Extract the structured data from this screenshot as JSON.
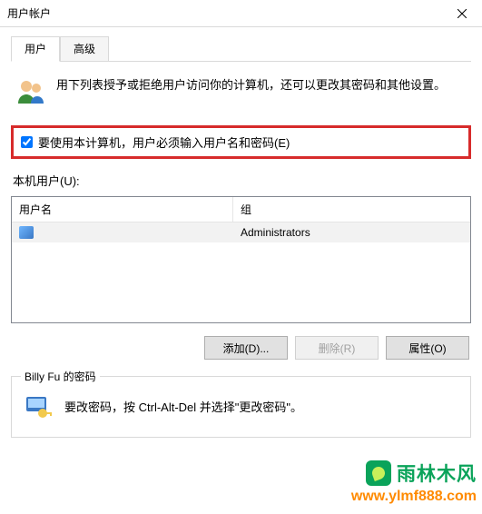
{
  "window": {
    "title": "用户帐户"
  },
  "tabs": {
    "user": "用户",
    "advanced": "高级"
  },
  "intro": {
    "text": "用下列表授予或拒绝用户访问你的计算机，还可以更改其密码和其他设置。"
  },
  "require_login": {
    "label": "要使用本计算机，用户必须输入用户名和密码(E)",
    "checked": true
  },
  "list": {
    "caption": "本机用户(U):",
    "col_name": "用户名",
    "col_group": "组",
    "rows": [
      {
        "name": "",
        "group": "Administrators"
      }
    ]
  },
  "buttons": {
    "add": "添加(D)...",
    "remove": "删除(R)",
    "props": "属性(O)"
  },
  "password_group": {
    "title": "Billy Fu 的密码",
    "text": "要改密码，按 Ctrl-Alt-Del 并选择\"更改密码\"。"
  },
  "watermark": {
    "brand": "雨林木风",
    "url": "www.ylmf888.com"
  }
}
